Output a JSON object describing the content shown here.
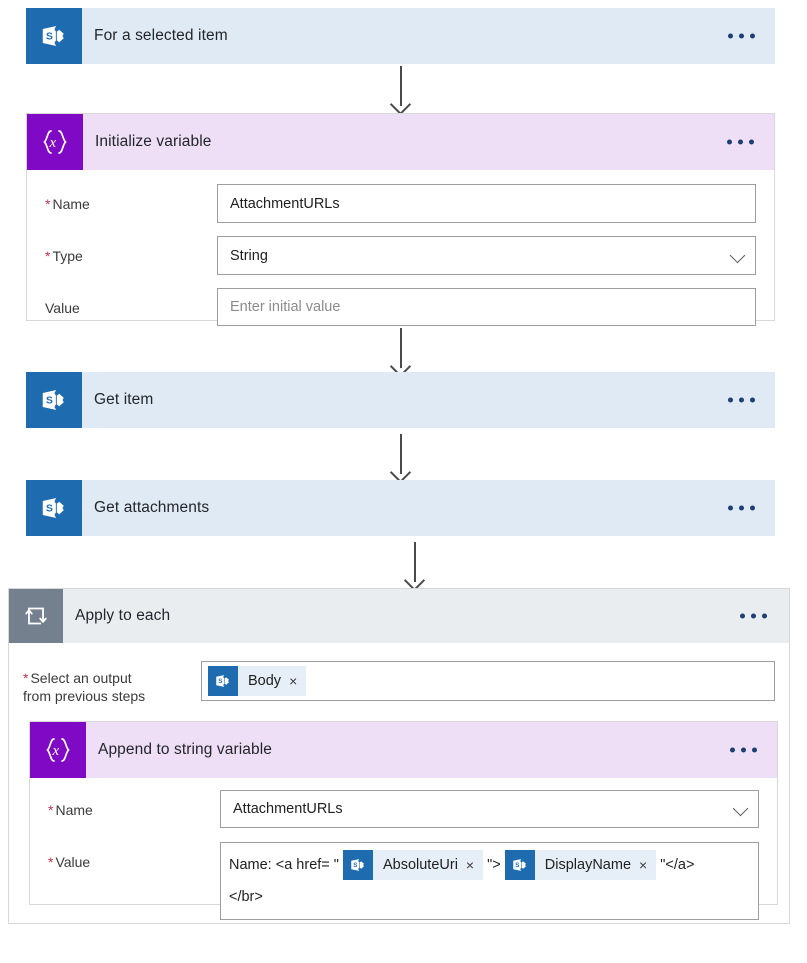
{
  "flow": {
    "steps": [
      {
        "id": "trigger",
        "title": "For a selected item",
        "icon": "sharepoint-icon",
        "theme": "blue",
        "menu": "more-options"
      },
      {
        "id": "init-variable",
        "title": "Initialize variable",
        "icon": "variable-icon",
        "theme": "purple",
        "menu": "more-options",
        "fields": [
          {
            "label": "Name",
            "required": true,
            "value": "AttachmentURLs",
            "placeholder": "",
            "control": "text"
          },
          {
            "label": "Type",
            "required": true,
            "value": "String",
            "placeholder": "",
            "control": "dropdown"
          },
          {
            "label": "Value",
            "required": false,
            "value": "",
            "placeholder": "Enter initial value",
            "control": "text"
          }
        ]
      },
      {
        "id": "get-item",
        "title": "Get item",
        "icon": "sharepoint-icon",
        "theme": "blue",
        "menu": "more-options"
      },
      {
        "id": "get-attachments",
        "title": "Get attachments",
        "icon": "sharepoint-icon",
        "theme": "blue",
        "menu": "more-options"
      }
    ],
    "loop": {
      "id": "apply-to-each",
      "title": "Apply to each",
      "icon": "loop-icon",
      "theme": "gray",
      "menu": "more-options",
      "select_output": {
        "label_line1": "Select an output",
        "label_line2": "from previous steps",
        "required": true,
        "token": {
          "text": "Body",
          "icon": "sharepoint-icon",
          "remove": "×"
        }
      },
      "nested": {
        "id": "append-to-string-variable",
        "title": "Append to string variable",
        "icon": "variable-icon",
        "theme": "purple",
        "menu": "more-options",
        "name_field": {
          "label": "Name",
          "required": true,
          "value": "AttachmentURLs",
          "control": "dropdown"
        },
        "value_field": {
          "label": "Value",
          "required": true,
          "parts": [
            {
              "kind": "text",
              "text": "Name: <a href= \""
            },
            {
              "kind": "token",
              "text": "AbsoluteUri",
              "icon": "sharepoint-icon",
              "remove": "×"
            },
            {
              "kind": "text",
              "text": "\">"
            },
            {
              "kind": "token",
              "text": "DisplayName",
              "icon": "sharepoint-icon",
              "remove": "×"
            },
            {
              "kind": "text",
              "text": "\"</a>"
            },
            {
              "kind": "break"
            },
            {
              "kind": "text",
              "text": "</br>"
            }
          ]
        }
      }
    }
  },
  "colors": {
    "sharepoint_blue": "#1f6bb0",
    "variable_purple": "#8009c5",
    "loop_gray": "#74808d",
    "header_blue": "#dfeaf4",
    "header_purple": "#eedff6",
    "header_gray": "#e9edf0",
    "required_red": "#c0334a",
    "token_chip": "#e6eff8",
    "arrow_gray": "#4a4a4a"
  }
}
